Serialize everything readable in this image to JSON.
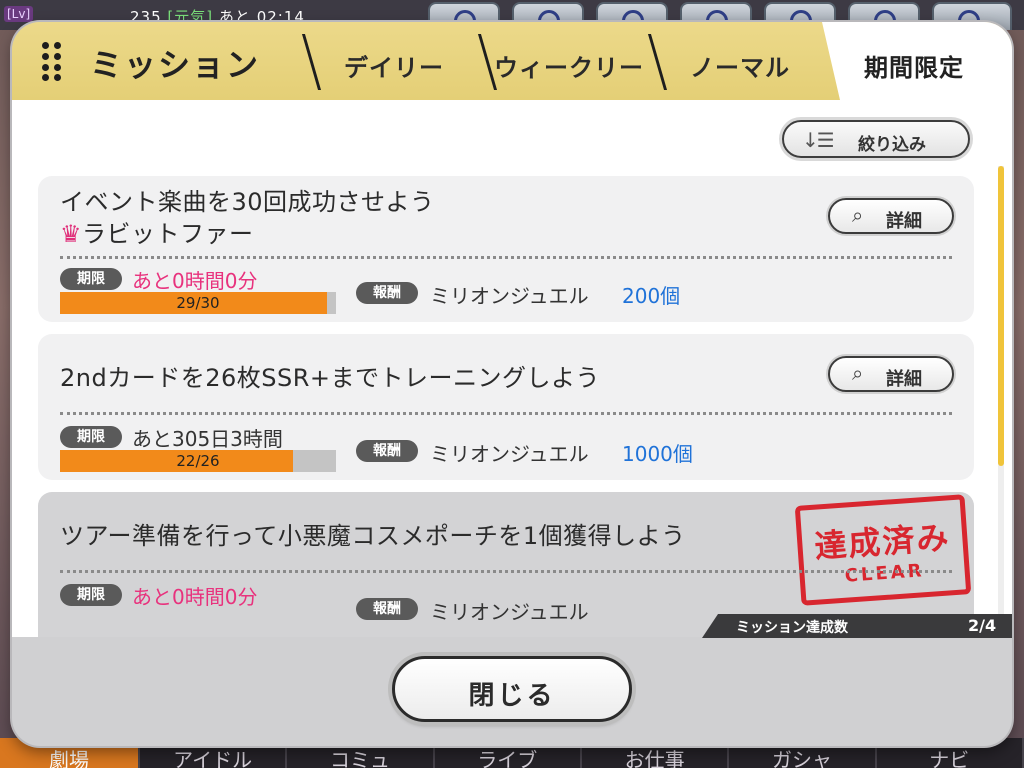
{
  "hud": {
    "level_badge": "[Lv]",
    "stamina_value": "235",
    "stamina_mood": "[元気]",
    "stamina_timer": "あと 02:14",
    "nav": [
      "劇場",
      "アイドル",
      "コミュ",
      "ライブ",
      "お仕事",
      "ガシャ",
      "ナビ"
    ]
  },
  "modal": {
    "title": "ミッション",
    "tabs": [
      {
        "label": "デイリー",
        "active": false
      },
      {
        "label": "ウィークリー",
        "active": false
      },
      {
        "label": "ノーマル",
        "active": false
      },
      {
        "label": "期間限定",
        "active": true
      }
    ],
    "filter_label": "絞り込み",
    "filter_icon": "sort-list-icon",
    "detail_label": "詳細",
    "deadline_tag": "期限",
    "reward_tag": "報酬",
    "missions": [
      {
        "title": "イベント楽曲を30回成功させよう",
        "subtitle": "ラビットファー",
        "subtitle_icon": "crown-icon",
        "deadline": "あと0時間0分",
        "deadline_urgent": true,
        "progress_text": "29/30",
        "progress": 0.967,
        "reward_name": "ミリオンジュエル",
        "reward_amount": "200個"
      },
      {
        "title": "2ndカードを26枚SSR+までトレーニングしよう",
        "deadline": "あと305日3時間",
        "deadline_urgent": false,
        "progress_text": "22/26",
        "progress": 0.846,
        "reward_name": "ミリオンジュエル",
        "reward_amount": "1000個"
      },
      {
        "title": "ツアー準備を行って小悪魔コスメポーチを1個獲得しよう",
        "deadline": "あと0時間0分",
        "deadline_urgent": true,
        "reward_name": "ミリオンジュエル",
        "completed_stamp": "達成済み",
        "completed_stamp_sub": "CLEAR"
      }
    ],
    "achievement_label": "ミッション達成数",
    "achievement_value": "2/4",
    "close_label": "閉じる"
  },
  "colors": {
    "header_gold": "#e8d47e",
    "progress_orange": "#f28a1a",
    "urgent_pink": "#e8327d",
    "reward_blue": "#1f72d8",
    "stamp_red": "#d8262f"
  }
}
